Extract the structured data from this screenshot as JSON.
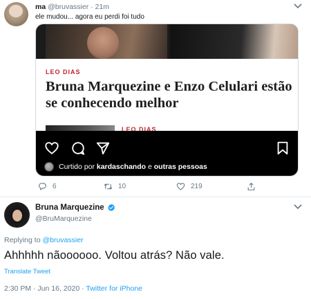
{
  "tweet1": {
    "name": "ma",
    "handle": "@bruvassier",
    "dot": "·",
    "time": "21m",
    "text": "ele mudou... agora eu perdi foi tudo",
    "card": {
      "section": "LEO DIAS",
      "headline": "Bruna Marquezine e Enzo Celulari estão se conhecendo melhor",
      "next_section": "LEO DIAS",
      "liked_prefix": "Curtido por ",
      "liked_user": "kardaschando",
      "liked_suffix": " e ",
      "liked_others": "outras pessoas"
    },
    "actions": {
      "replies": "6",
      "retweets": "10",
      "likes": "219"
    }
  },
  "tweet2": {
    "name": "Bruna Marquezine",
    "handle": "@BruMarquezine",
    "replying_prefix": "Replying to ",
    "replying_handle": "@bruvassier",
    "text": "Ahhhhh nãoooooo. Voltou atrás? Não vale.",
    "translate": "Translate Tweet",
    "timestamp": "2:30 PM · Jun 16, 2020",
    "separator": " · ",
    "source": "Twitter for iPhone"
  },
  "colors": {
    "link": "#1da1f2",
    "muted": "#657786",
    "headline_red": "#c4222b"
  }
}
